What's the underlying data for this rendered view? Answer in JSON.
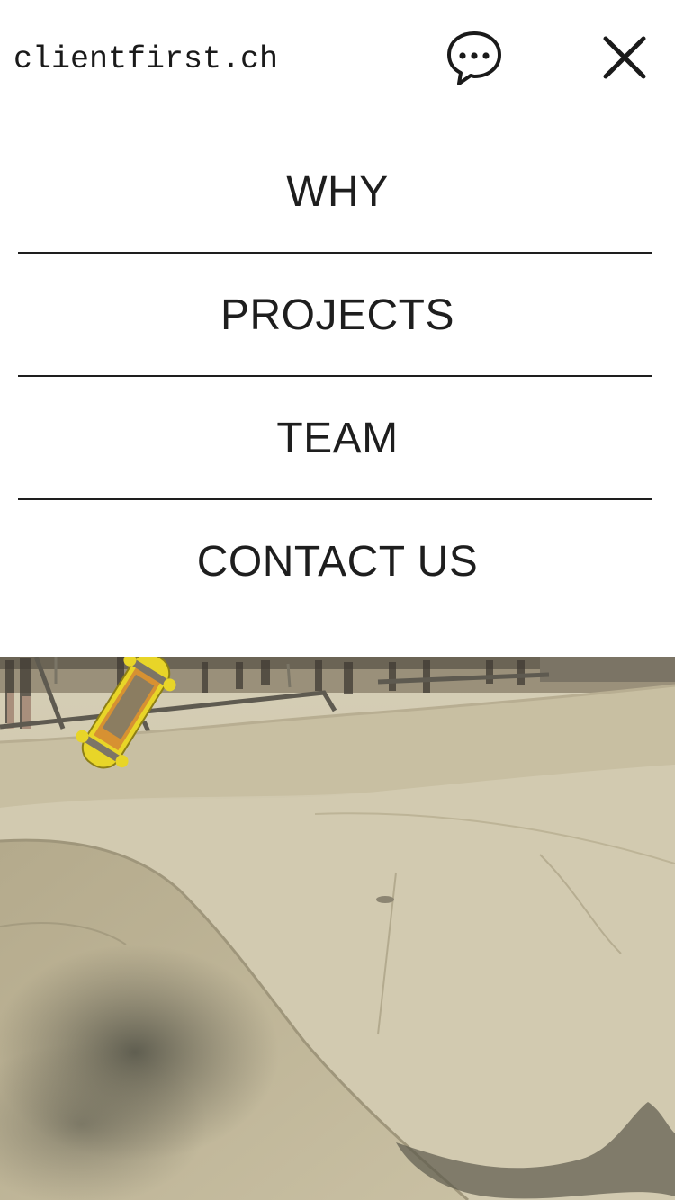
{
  "header": {
    "logo_text": "clientfirst.ch",
    "chat_icon": "chat-bubble-icon",
    "close_icon": "close-icon"
  },
  "menu": {
    "items": [
      {
        "label": "WHY"
      },
      {
        "label": "PROJECTS"
      },
      {
        "label": "TEAM"
      },
      {
        "label": "CONTACT US"
      }
    ]
  },
  "hero": {
    "subject": "skatepark-bowl-photo",
    "colors": {
      "concrete": "#cfc6ac",
      "shadow": "#5a5a4c",
      "skateboard": "#e8d528"
    }
  }
}
